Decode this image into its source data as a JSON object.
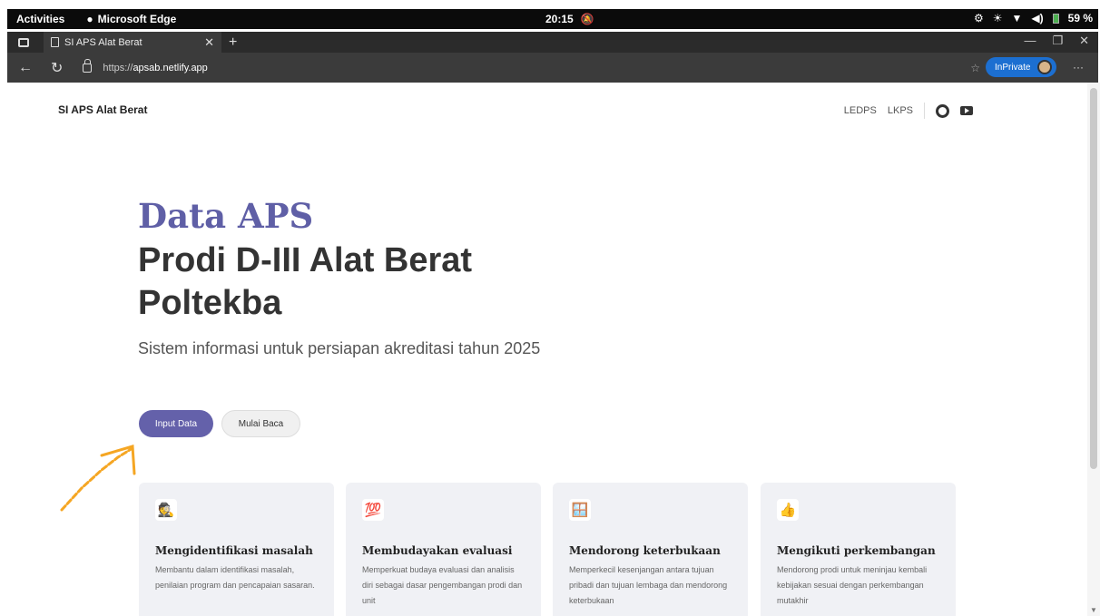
{
  "system_bar": {
    "activities": "Activities",
    "app_name": "Microsoft Edge",
    "clock": "20:15",
    "battery": "59 %"
  },
  "browser": {
    "tab_title": "SI APS Alat Berat",
    "url_scheme": "https://",
    "url_host": "apsab.netlify.app",
    "inprivate_label": "InPrivate"
  },
  "site": {
    "title": "SI APS Alat Berat",
    "nav": [
      "LEDPS",
      "LKPS"
    ]
  },
  "hero": {
    "line1": "Data APS",
    "line2": "Prodi D-III Alat Berat Poltekba",
    "subtitle": "Sistem informasi untuk persiapan akreditasi tahun 2025",
    "primary_button": "Input Data",
    "secondary_button": "Mulai Baca"
  },
  "cards": [
    {
      "icon": "🕵",
      "title": "Mengidentifikasi masalah",
      "desc": "Membantu dalam identifikasi masalah, penilaian program dan pencapaian sasaran."
    },
    {
      "icon": "💯",
      "title": "Membudayakan evaluasi",
      "desc": "Memperkuat budaya evaluasi dan analisis diri sebagai dasar pengembangan prodi dan unit"
    },
    {
      "icon": "🪟",
      "title": "Mendorong keterbukaan",
      "desc": "Memperkecil kesenjangan antara tujuan pribadi dan tujuan lembaga dan mendorong keterbukaan"
    },
    {
      "icon": "👍",
      "title": "Mengikuti perkembangan",
      "desc": "Mendorong prodi untuk meninjau kembali kebijakan sesuai dengan perkembangan mutakhir"
    }
  ],
  "colors": {
    "accent": "#6461aa",
    "annotation": "#f5a623"
  }
}
